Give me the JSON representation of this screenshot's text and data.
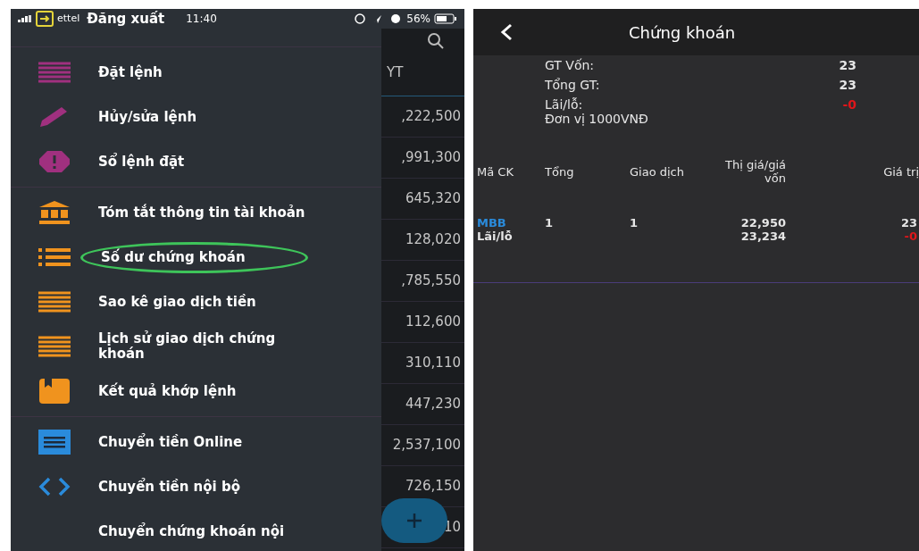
{
  "left_screen": {
    "status_bar": {
      "carrier": "ettel",
      "logout_label": "Đăng xuất",
      "time": "11:40",
      "battery": "56%"
    },
    "menu_groups": [
      [
        {
          "label": "Đặt lệnh",
          "kind": "lines",
          "highlighted": false
        },
        {
          "label": "Hủy/sửa lệnh",
          "kind": "pencil",
          "highlighted": false
        },
        {
          "label": "Sổ lệnh đặt",
          "kind": "alert",
          "highlighted": false
        }
      ],
      [
        {
          "label": "Tóm tắt thông tin tài khoản",
          "kind": "bank",
          "highlighted": false
        },
        {
          "label": "Số dư chứng khoán",
          "kind": "list",
          "highlighted": true
        },
        {
          "label": "Sao kê giao dịch tiền",
          "kind": "lines",
          "highlighted": false
        },
        {
          "label": "Lịch sử giao dịch chứng khoán",
          "kind": "lines",
          "highlighted": false
        },
        {
          "label": "Kết quả khớp lệnh",
          "kind": "bookmark",
          "highlighted": false
        }
      ],
      [
        {
          "label": "Chuyển tiền Online",
          "kind": "receipt",
          "highlighted": false
        },
        {
          "label": "Chuyển tiền nội bộ",
          "kind": "code",
          "highlighted": false
        },
        {
          "label": "Chuyển chứng khoán nội",
          "kind": "plain",
          "highlighted": false
        }
      ]
    ],
    "background_list": {
      "header": "YT",
      "values": [
        ",222,500",
        ",991,300",
        "645,320",
        "128,020",
        ",785,550",
        "112,600",
        "310,110",
        "447,230",
        "2,537,100",
        "726,150",
        "10"
      ]
    }
  },
  "right_screen": {
    "title": "Chứng khoán",
    "summary": [
      {
        "label": "GT Vốn:",
        "value": "23",
        "negative": false
      },
      {
        "label": "Tổng GT:",
        "value": "23",
        "negative": false
      },
      {
        "label": "Lãi/lỗ:",
        "value": "-0",
        "negative": true
      }
    ],
    "unit_note": "Đơn vị 1000VNĐ",
    "table": {
      "columns": [
        "Mã CK",
        "Tổng",
        "Giao dịch",
        "Thị giá/giá vốn",
        "Giá trị"
      ],
      "rows": [
        {
          "symbol": "MBB",
          "symbol_sub": "Lãi/lỗ",
          "total": "1",
          "tradable": "1",
          "market_price": "22,950",
          "cost_price": "23,234",
          "value": "23",
          "profit": "-0",
          "profit_negative": true
        }
      ]
    }
  }
}
